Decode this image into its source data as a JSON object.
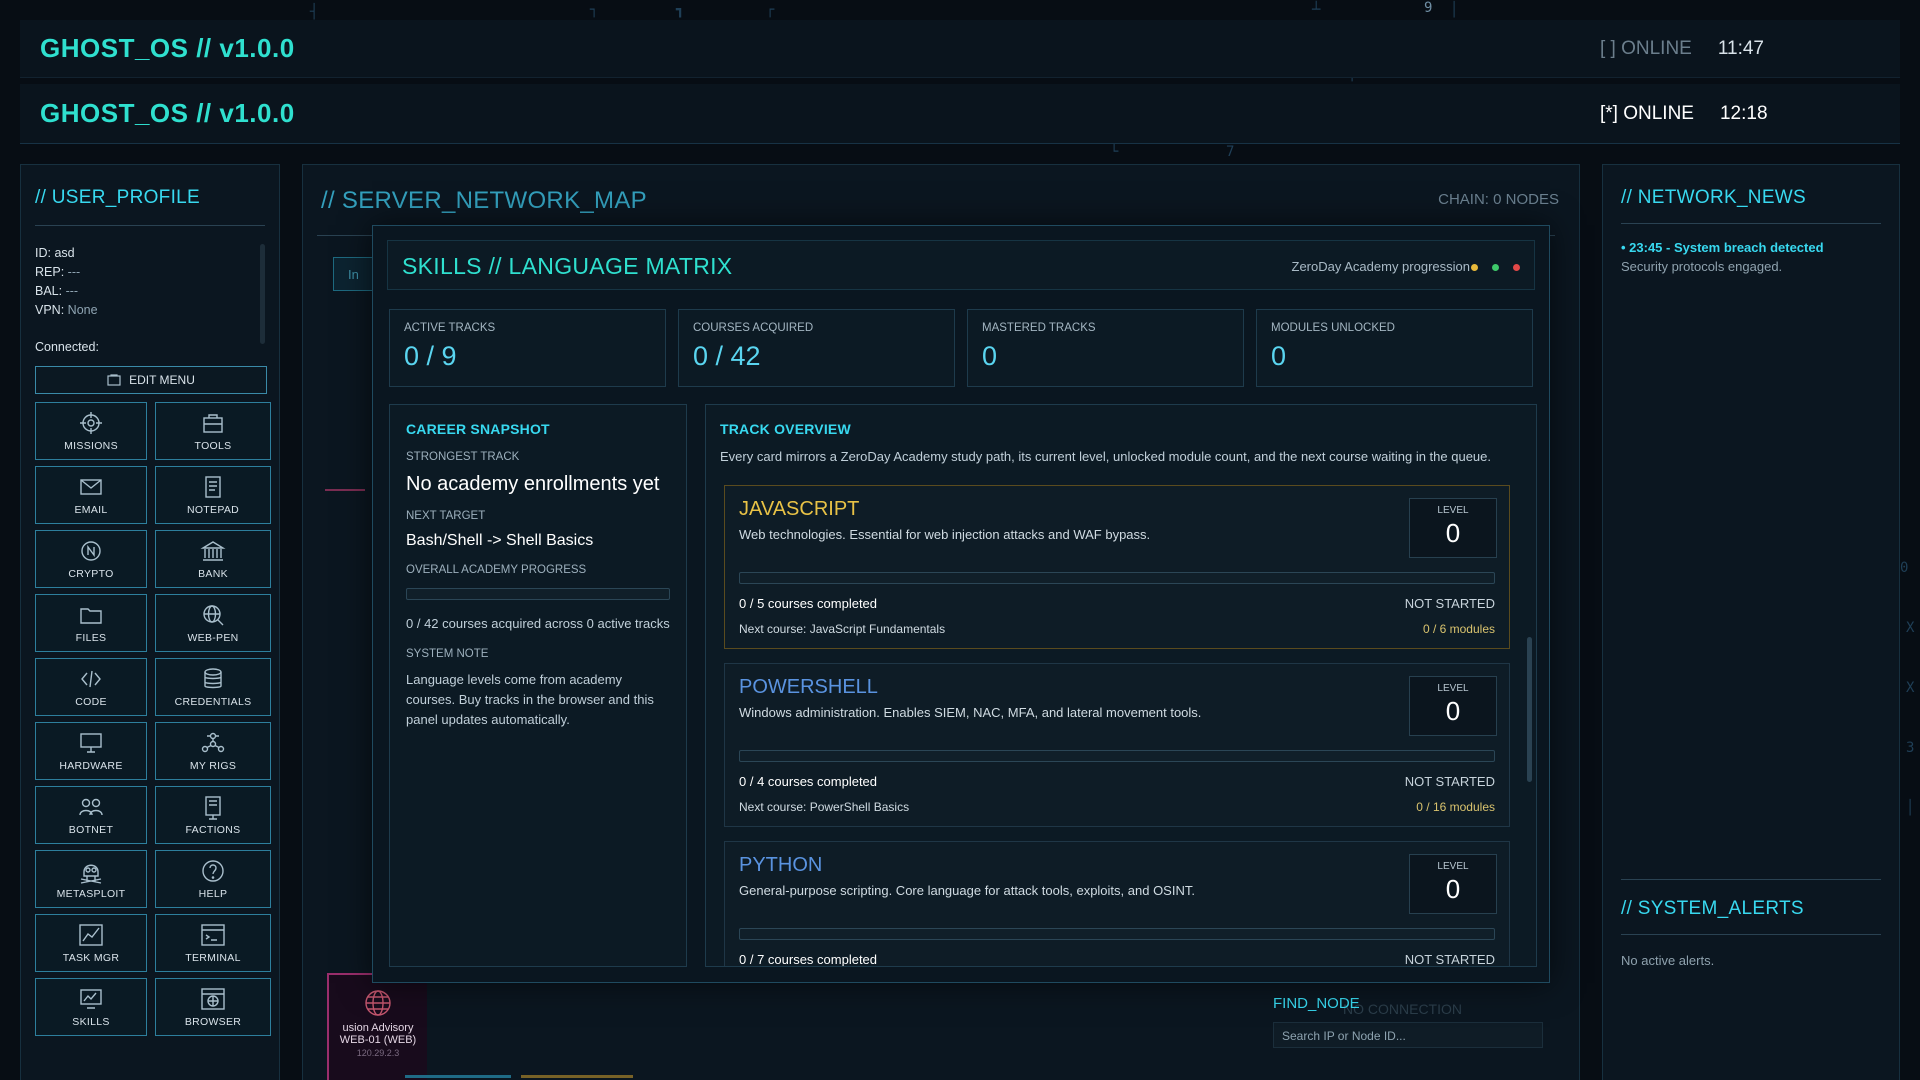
{
  "header_back": {
    "brand": "GHOST_OS // v1.0.0",
    "status": "[ ] ONLINE",
    "clock": "11:47"
  },
  "header": {
    "brand": "GHOST_OS // v1.0.0",
    "status": "[*] ONLINE",
    "clock": "12:18"
  },
  "profile": {
    "title": "// USER_PROFILE",
    "id_label": "ID:",
    "id_value": "asd",
    "rep_label": "REP:",
    "rep_value": "---",
    "bal_label": "BAL:",
    "bal_value": "---",
    "vpn_label": "VPN:",
    "vpn_value": "None",
    "connected_label": "Connected:",
    "edit_menu": "EDIT MENU"
  },
  "apps": [
    {
      "label": "MISSIONS",
      "icon": "crosshair-icon"
    },
    {
      "label": "TOOLS",
      "icon": "toolbox-icon"
    },
    {
      "label": "EMAIL",
      "icon": "envelope-icon"
    },
    {
      "label": "NOTEPAD",
      "icon": "notepad-icon"
    },
    {
      "label": "CRYPTO",
      "icon": "coin-icon"
    },
    {
      "label": "BANK",
      "icon": "bank-icon"
    },
    {
      "label": "FILES",
      "icon": "folder-icon"
    },
    {
      "label": "WEB-PEN",
      "icon": "globe-search-icon"
    },
    {
      "label": "CODE",
      "icon": "code-icon"
    },
    {
      "label": "CREDENTIALS",
      "icon": "database-icon"
    },
    {
      "label": "HARDWARE",
      "icon": "monitor-icon"
    },
    {
      "label": "MY RIGS",
      "icon": "network-icon"
    },
    {
      "label": "BOTNET",
      "icon": "users-icon"
    },
    {
      "label": "FACTIONS",
      "icon": "flag-icon"
    },
    {
      "label": "METASPLOIT",
      "icon": "skull-icon"
    },
    {
      "label": "HELP",
      "icon": "question-icon"
    },
    {
      "label": "TASK MGR",
      "icon": "chart-icon"
    },
    {
      "label": "TERMINAL",
      "icon": "terminal-icon"
    },
    {
      "label": "SKILLS",
      "icon": "skills-icon"
    },
    {
      "label": "BROWSER",
      "icon": "browser-icon"
    }
  ],
  "network_map": {
    "title": "// SERVER_NETWORK_MAP",
    "chain": "CHAIN: 0 NODES",
    "tab_fragment": "In",
    "node": {
      "name": "usion Advisory",
      "host": "WEB-01 (WEB)",
      "ip": "120.29.2.3"
    },
    "find_node": {
      "label": "FIND_NODE",
      "placeholder": "Search IP or Node ID..."
    },
    "faded_label": "NO CONNECTION"
  },
  "skills": {
    "title": "SKILLS // LANGUAGE MATRIX",
    "subtitle": "ZeroDay Academy progression",
    "dot_colors": [
      "#e8b93a",
      "#3ec96a",
      "#e24848"
    ],
    "stats": [
      {
        "label": "ACTIVE TRACKS",
        "value": "0 / 9"
      },
      {
        "label": "COURSES ACQUIRED",
        "value": "0 / 42"
      },
      {
        "label": "MASTERED TRACKS",
        "value": "0"
      },
      {
        "label": "MODULES UNLOCKED",
        "value": "0"
      }
    ],
    "career": {
      "title": "CAREER SNAPSHOT",
      "strongest_label": "STRONGEST TRACK",
      "strongest_value": "No academy enrollments yet",
      "next_label": "NEXT TARGET",
      "next_value": "Bash/Shell -> Shell Basics",
      "overall_label": "OVERALL ACADEMY PROGRESS",
      "overall_progress": 0,
      "overall_text": "0 / 42 courses acquired across 0 active tracks",
      "note_label": "SYSTEM NOTE",
      "note_text": "Language levels come from academy courses. Buy tracks in the browser and this panel updates automatically."
    },
    "overview": {
      "title": "TRACK OVERVIEW",
      "desc": "Every card mirrors a ZeroDay Academy study path, its current level, unlocked module count, and the next course waiting in the queue."
    },
    "tracks": [
      {
        "name": "JAVASCRIPT",
        "color": "#e8c246",
        "desc": "Web technologies. Essential for web injection attacks and WAF bypass.",
        "level_label": "LEVEL",
        "level": "0",
        "progress": 0,
        "courses": "0 / 5 courses completed",
        "status": "NOT STARTED",
        "next": "Next course: JavaScript Fundamentals",
        "modules": "0 / 6 modules"
      },
      {
        "name": "POWERSHELL",
        "color": "#5a93e0",
        "desc": "Windows administration. Enables SIEM, NAC, MFA, and lateral movement tools.",
        "level_label": "LEVEL",
        "level": "0",
        "progress": 0,
        "courses": "0 / 4 courses completed",
        "status": "NOT STARTED",
        "next": "Next course: PowerShell Basics",
        "modules": "0 / 16 modules"
      },
      {
        "name": "PYTHON",
        "color": "#5a93e0",
        "desc": "General-purpose scripting. Core language for attack tools, exploits, and OSINT.",
        "level_label": "LEVEL",
        "level": "0",
        "progress": 0,
        "courses": "0 / 7 courses completed",
        "status": "NOT STARTED",
        "next": "",
        "modules": ""
      }
    ]
  },
  "news": {
    "title": "// NETWORK_NEWS",
    "items": [
      {
        "time_title": "• 23:45 - System breach detected",
        "detail": "Security protocols engaged."
      }
    ]
  },
  "alerts": {
    "title": "// SYSTEM_ALERTS",
    "empty": "No active alerts."
  }
}
